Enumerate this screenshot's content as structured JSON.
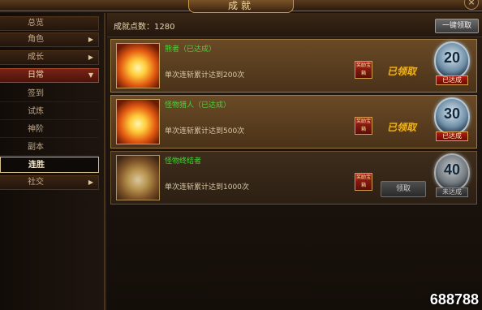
{
  "window": {
    "title": "成就",
    "close_label": "×"
  },
  "sidebar": {
    "items": [
      {
        "label": "总览",
        "has_arrow": false
      },
      {
        "label": "角色",
        "arrow": "▶"
      },
      {
        "label": "成长",
        "arrow": "▶"
      },
      {
        "label": "日常",
        "arrow": "▼"
      }
    ],
    "subitems": [
      "签到",
      "试炼",
      "神阶",
      "副本",
      "连胜"
    ],
    "last_item": {
      "label": "社交",
      "arrow": "▶"
    }
  },
  "header": {
    "points_label": "成就点数：1280",
    "claim_all_label": "一键领取"
  },
  "achievements": [
    {
      "title": "熊者（已达成）",
      "desc": "单次连斩累计达到200次",
      "reward_text": "奖励宝箱",
      "status": "已领取",
      "badge_number": "20",
      "badge_status": "已达成"
    },
    {
      "title": "怪物猎人（已达成）",
      "desc": "单次连斩累计达到500次",
      "reward_text": "奖励宝箱",
      "status": "已领取",
      "badge_number": "30",
      "badge_status": "已达成"
    },
    {
      "title": "怪物终结者",
      "desc": "单次连斩累计达到1000次",
      "reward_text": "奖励宝箱",
      "button_label": "领取",
      "badge_number": "40",
      "badge_status": "未达成"
    }
  ],
  "watermark": "688788",
  "colors": {
    "title_green": "#4cd13a",
    "claimed_gold": "#f0b41a",
    "active_tab": "#7a2216"
  }
}
